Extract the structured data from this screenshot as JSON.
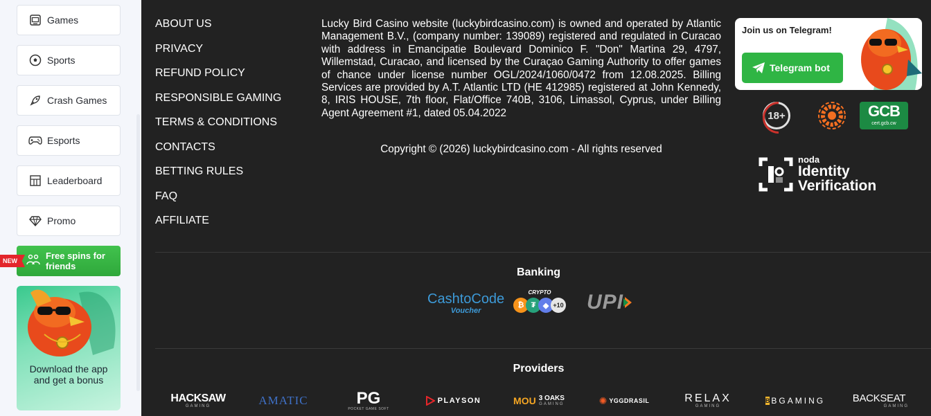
{
  "sidebar": {
    "items": [
      {
        "label": "Games",
        "icon": "games-icon"
      },
      {
        "label": "Sports",
        "icon": "soccer-ball-icon"
      },
      {
        "label": "Crash Games",
        "icon": "rocket-icon"
      },
      {
        "label": "Esports",
        "icon": "gamepad-icon"
      },
      {
        "label": "Leaderboard",
        "icon": "leaderboard-icon"
      },
      {
        "label": "Promo",
        "icon": "diamond-icon"
      }
    ],
    "free_spins": {
      "label": "Free spins for friends",
      "badge": "NEW"
    },
    "app_promo": {
      "label": "Download the app and get a bonus"
    }
  },
  "footer": {
    "links": [
      "ABOUT US",
      "PRIVACY",
      "REFUND POLICY",
      "RESPONSIBLE GAMING",
      "TERMS & CONDITIONS",
      "CONTACTS",
      "BETTING RULES",
      "FAQ",
      "AFFILIATE"
    ],
    "legal": "Lucky Bird Casino website (luckybirdcasino.com) is owned and operated by Atlantic Management B.V., (company number: 139089) registered and regulated in Curacao with address in Emancipatie Boulevard Dominico F. \"Don\" Martina 29, 4797, Willemstad, Curacao, and licensed by the Curaçao Gaming Authority to offer games of chance under license number OGL/2024/1060/0472 from 12.08.2025. Billing Services are provided by A.T. Atlantic LTD (HE 412985) registered at John Kennedy, 8, IRIS HOUSE, 7th floor, Flat/Office 740B, 3106, Limassol, Cyprus, under Billing Agent Agreement #1, dated 05.04.2022",
    "copyright": "Copyright © (2026) luckybirdcasino.com - All rights reserved",
    "telegram": {
      "title": "Join us on Telegram!",
      "button": "Telegram bot"
    },
    "badges": {
      "age": "18+",
      "gcb": "GCB",
      "gcb_sub": "cert.gcb.cw"
    },
    "noda": {
      "small": "noda",
      "line1": "Identity",
      "line2": "Verification"
    },
    "banking": {
      "title": "Banking",
      "cashtocode": "CashtoCode",
      "cashtocode_sub": "Voucher",
      "crypto_label": "CRYPTO",
      "crypto_more": "+10",
      "upi": "UPI"
    },
    "providers": {
      "title": "Providers",
      "items": [
        {
          "main": "HACKSAW",
          "sub": "GAMING"
        },
        {
          "main": "AMATIC",
          "sub": ""
        },
        {
          "main": "PG",
          "sub": "POCKET GAME SOFT"
        },
        {
          "main": "PLAYSON",
          "sub": ""
        },
        {
          "main": "3 OAKS",
          "sub": "GAMING"
        },
        {
          "main": "YGGDRASIL",
          "sub": ""
        },
        {
          "main": "RELAX",
          "sub": "GAMING"
        },
        {
          "main": "BGAMING",
          "sub": ""
        },
        {
          "main": "BACKSEAT",
          "sub": "GAMING"
        }
      ]
    }
  },
  "colors": {
    "footer_bg": "#222222",
    "sidebar_bg": "#f4f6fb",
    "green": "#2fb544",
    "gcb_green": "#1c8a43"
  }
}
